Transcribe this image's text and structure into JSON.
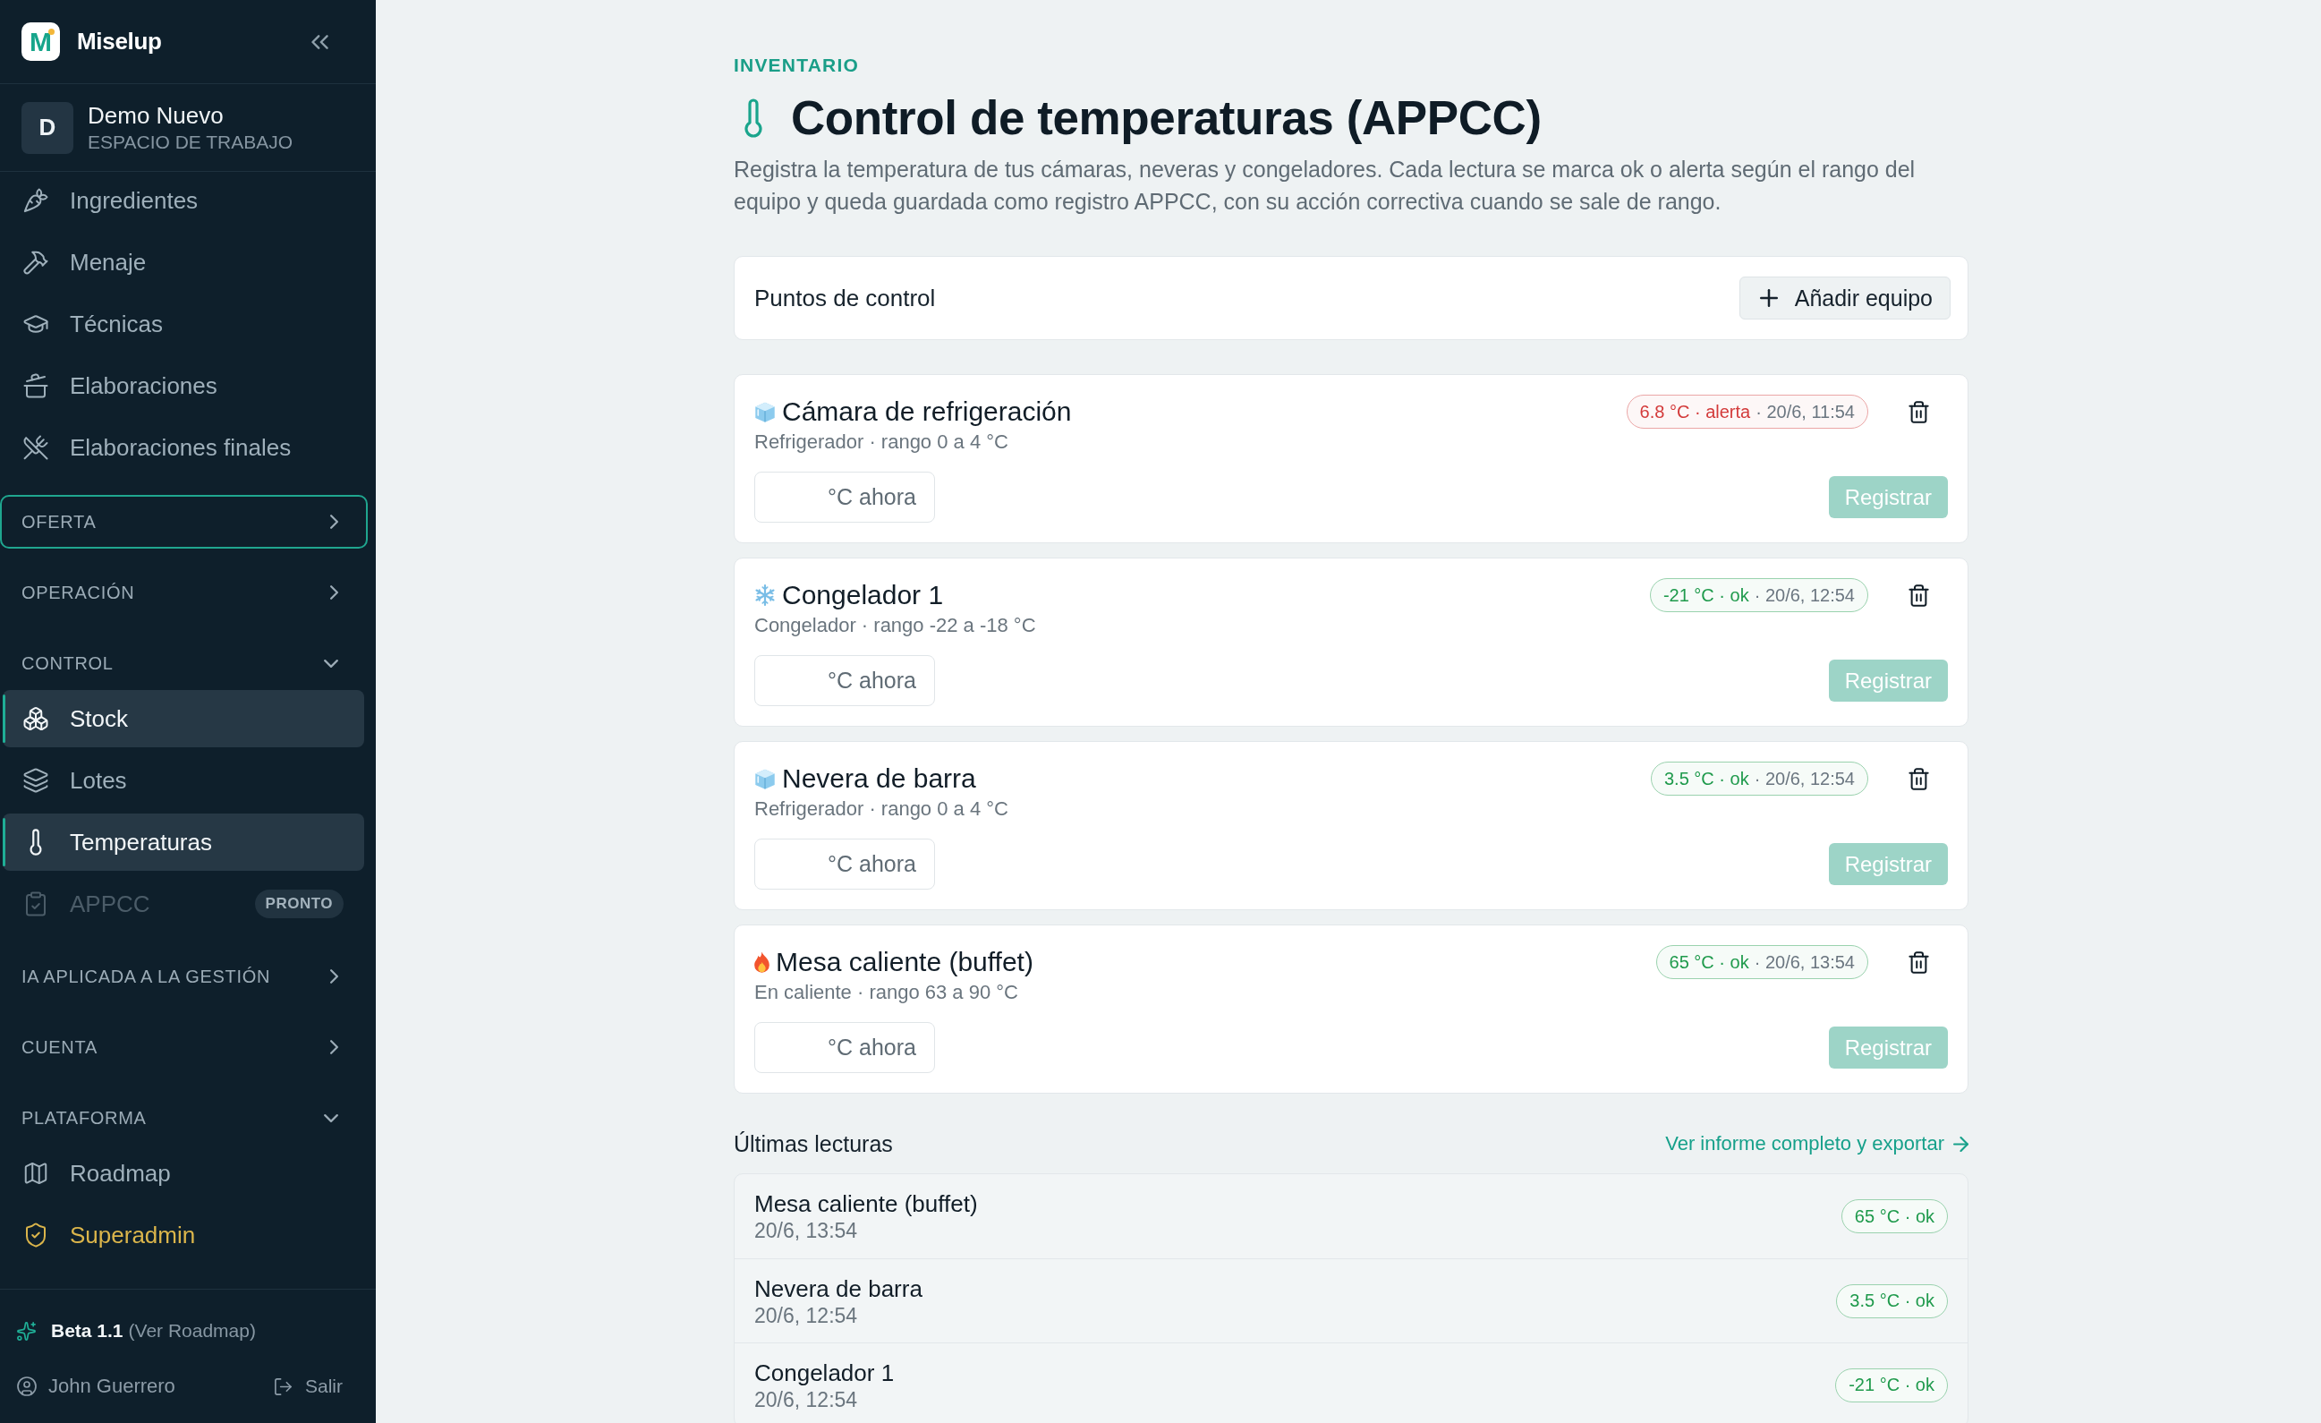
{
  "sidebar": {
    "brand": {
      "mark": "M",
      "name": "Miselup"
    },
    "workspace": {
      "initial": "D",
      "name": "Demo Nuevo",
      "label": "ESPACIO DE TRABAJO"
    },
    "items": [
      {
        "label": "Ingredientes",
        "selected": false
      },
      {
        "label": "Menaje",
        "selected": false
      },
      {
        "label": "Técnicas",
        "selected": false
      },
      {
        "label": "Elaboraciones",
        "selected": false
      },
      {
        "label": "Elaboraciones finales",
        "selected": false
      }
    ],
    "sections": [
      {
        "title": "OFERTA",
        "expanded": false,
        "focused": true
      },
      {
        "title": "OPERACIÓN",
        "expanded": false,
        "focused": false
      },
      {
        "title": "CONTROL",
        "expanded": true,
        "focused": false,
        "items": [
          {
            "label": "Stock",
            "selected": true,
            "disabled": false
          },
          {
            "label": "Lotes",
            "selected": false,
            "disabled": false
          },
          {
            "label": "Temperaturas",
            "selected": true,
            "disabled": false
          },
          {
            "label": "APPCC",
            "selected": false,
            "disabled": true,
            "badge": "PRONTO"
          }
        ]
      },
      {
        "title": "IA APLICADA A LA GESTIÓN",
        "expanded": false,
        "focused": false
      },
      {
        "title": "CUENTA",
        "expanded": false,
        "focused": false
      },
      {
        "title": "PLATAFORMA",
        "expanded": true,
        "focused": false,
        "items": [
          {
            "label": "Roadmap",
            "selected": false,
            "kind": "page"
          },
          {
            "label": "Superadmin",
            "selected": false,
            "kind": "admin"
          }
        ]
      }
    ],
    "footer": {
      "version": "Beta 1.1",
      "version_link": "(Ver Roadmap)",
      "user": "John Guerrero",
      "logout": "Salir"
    }
  },
  "header": {
    "eyebrow": "INVENTARIO",
    "title": "Control de temperaturas (APPCC)",
    "description": "Registra la temperatura de tus cámaras, neveras y congeladores. Cada lectura se marca ok o alerta según el rango del equipo y queda guardada como registro APPCC, con su acción correctiva cuando se sale de rango."
  },
  "control_points": {
    "title": "Puntos de control",
    "add_button": "Añadir equipo",
    "equipment": [
      {
        "kind": "fridge",
        "name": "Cámara de refrigeración",
        "details": "Refrigerador · rango 0 a 4 °C",
        "reading": "6.8 °C · alerta",
        "color": "#d33a3a",
        "time": "· 20/6, 11:54",
        "placeholder": "°C ahora",
        "register": {
          "label": "Registrar",
          "disabled": true
        }
      },
      {
        "kind": "freezer",
        "name": "Congelador 1",
        "details": "Congelador · rango -22 a -18 °C",
        "reading": "-21 °C · ok",
        "color": "#1f9a4c",
        "time": "· 20/6, 12:54",
        "placeholder": "°C ahora",
        "register": {
          "label": "Registrar",
          "disabled": true
        }
      },
      {
        "kind": "fridge",
        "name": "Nevera de barra",
        "details": "Refrigerador · rango 0 a 4 °C",
        "reading": "3.5 °C · ok",
        "color": "#1f9a4c",
        "time": "· 20/6, 12:54",
        "placeholder": "°C ahora",
        "register": {
          "label": "Registrar",
          "disabled": true
        }
      },
      {
        "kind": "hot",
        "name": "Mesa caliente (buffet)",
        "details": "En caliente · rango 63 a 90 °C",
        "reading": "65 °C · ok",
        "color": "#1f9a4c",
        "time": "· 20/6, 13:54",
        "placeholder": "°C ahora",
        "register": {
          "label": "Registrar",
          "disabled": true
        }
      }
    ]
  },
  "recent_readings": {
    "title": "Últimas lecturas",
    "link": "Ver informe completo y exportar",
    "rows": [
      {
        "name": "Mesa caliente (buffet)",
        "time": "20/6, 13:54",
        "reading": "65 °C · ok",
        "color": "#1f9a4c"
      },
      {
        "name": "Nevera de barra",
        "time": "20/6, 12:54",
        "reading": "3.5 °C · ok",
        "color": "#1f9a4c"
      },
      {
        "name": "Congelador 1",
        "time": "20/6, 12:54",
        "reading": "-21 °C · ok",
        "color": "#1f9a4c"
      }
    ]
  }
}
